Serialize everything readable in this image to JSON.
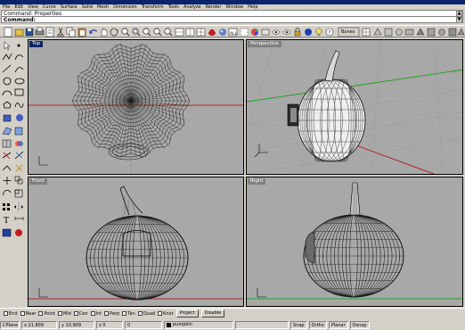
{
  "menu": [
    "File",
    "Edit",
    "View",
    "Curve",
    "Surface",
    "Solid",
    "Mesh",
    "Dimension",
    "Transform",
    "Tools",
    "Analyze",
    "Render",
    "Window",
    "Help"
  ],
  "command_history": "Command:  Properties",
  "command_prompt": "Command:",
  "toolbar_boxed_label": "Bones",
  "viewports": [
    {
      "title": "Top",
      "active": true
    },
    {
      "title": "Perspective",
      "active": false
    },
    {
      "title": "Front",
      "active": false
    },
    {
      "title": "Right",
      "active": false
    }
  ],
  "osnaps": [
    "End",
    "Near",
    "Point",
    "Mid",
    "Cen",
    "Int",
    "Perp",
    "Tan",
    "Quad",
    "Knot"
  ],
  "osnap_buttons": [
    "Project",
    "Disable"
  ],
  "status": {
    "plane": "CPlane",
    "x": "x 21.809",
    "y": "y 10.909",
    "z": "z 0",
    "extra": "0",
    "layer": "pumpkin",
    "toggles": [
      "Snap",
      "Ortho",
      "Planar",
      "Osnap"
    ]
  },
  "colors": {
    "active_title": "#0a246a",
    "viewport_bg": "#a8a8a8",
    "x_axis": "#b00000",
    "y_axis": "#00a000"
  }
}
